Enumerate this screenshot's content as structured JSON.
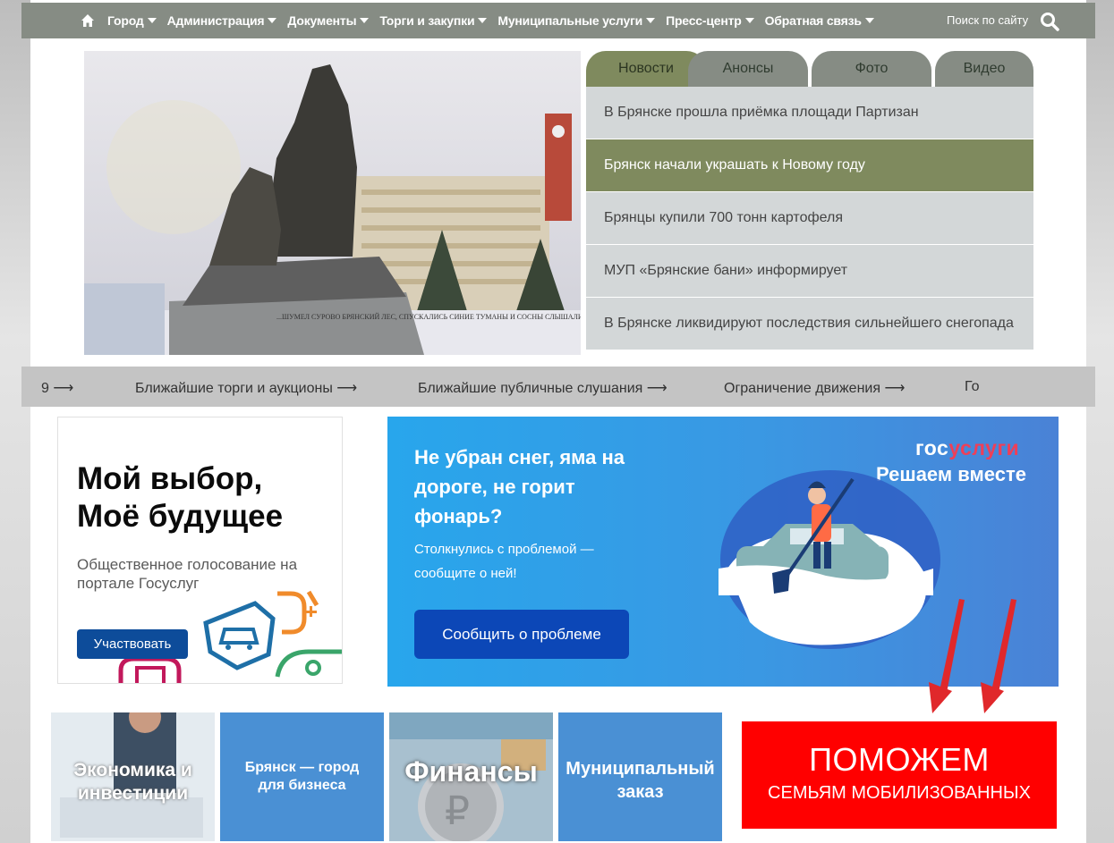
{
  "nav": {
    "items": [
      "Город",
      "Администрация",
      "Документы",
      "Торги и закупки",
      "Муниципальные услуги",
      "Пресс-центр",
      "Обратная связь"
    ],
    "search_label": "Поиск по сайту"
  },
  "hero": {
    "monument_text": "...ШУМЕЛ СУРОВО БРЯНСКИЙ ЛЕС, СПУСКАЛИСЬ СИНИЕ ТУМАНЫ И СОСНЫ СЛЫШАЛИ ОКРЕСТ..."
  },
  "news": {
    "tabs": [
      "Новости",
      "Анонсы",
      "Фото",
      "Видео"
    ],
    "active_tab": 0,
    "items": [
      "В Брянске прошла приёмка площади Партизан",
      "Брянск начали украшать к Новому году",
      "Брянцы купили 700 тонн картофеля",
      "МУП «Брянские бани» информирует",
      "В Брянске ликвидируют последствия сильнейшего снегопада"
    ],
    "active_item": 1
  },
  "ticker": {
    "items": [
      "9 ⟶",
      "Ближайшие торги и аукционы ⟶",
      "Ближайшие публичные слушания ⟶",
      "Ограничение движения ⟶",
      "Го"
    ]
  },
  "vote_card": {
    "title_line1": "Мой выбор,",
    "title_line2": "Моё будущее",
    "subtitle": "Общественное голосование на портале Госуслуг",
    "button": "Участвовать"
  },
  "gos_card": {
    "question": "Не убран снег, яма на дороге, не горит фонарь?",
    "subtitle": "Столкнулись с проблемой — сообщите о ней!",
    "button": "Сообщить о проблеме",
    "brand_gos": "гос",
    "brand_uslugi": "услуги",
    "brand_sub": "Решаем вместе"
  },
  "tiles": [
    {
      "label": "Экономика и инвестиции"
    },
    {
      "label": "Брянск — город для бизнеса"
    },
    {
      "label": "Финансы"
    },
    {
      "label": "Муниципальный заказ"
    }
  ],
  "help_banner": {
    "line1": "ПОМОЖЕМ",
    "line2": "СЕМЬЯМ МОБИЛИЗОВАННЫХ"
  },
  "colors": {
    "nav_bg": "#868c84",
    "olive": "#7f8a5e",
    "news_bg": "#d3d7d8",
    "ticker_bg": "#c4c4c4",
    "gos_blue": "#0c47b7",
    "help_red": "#ff0000",
    "tile_blue": "#4a90d4"
  }
}
